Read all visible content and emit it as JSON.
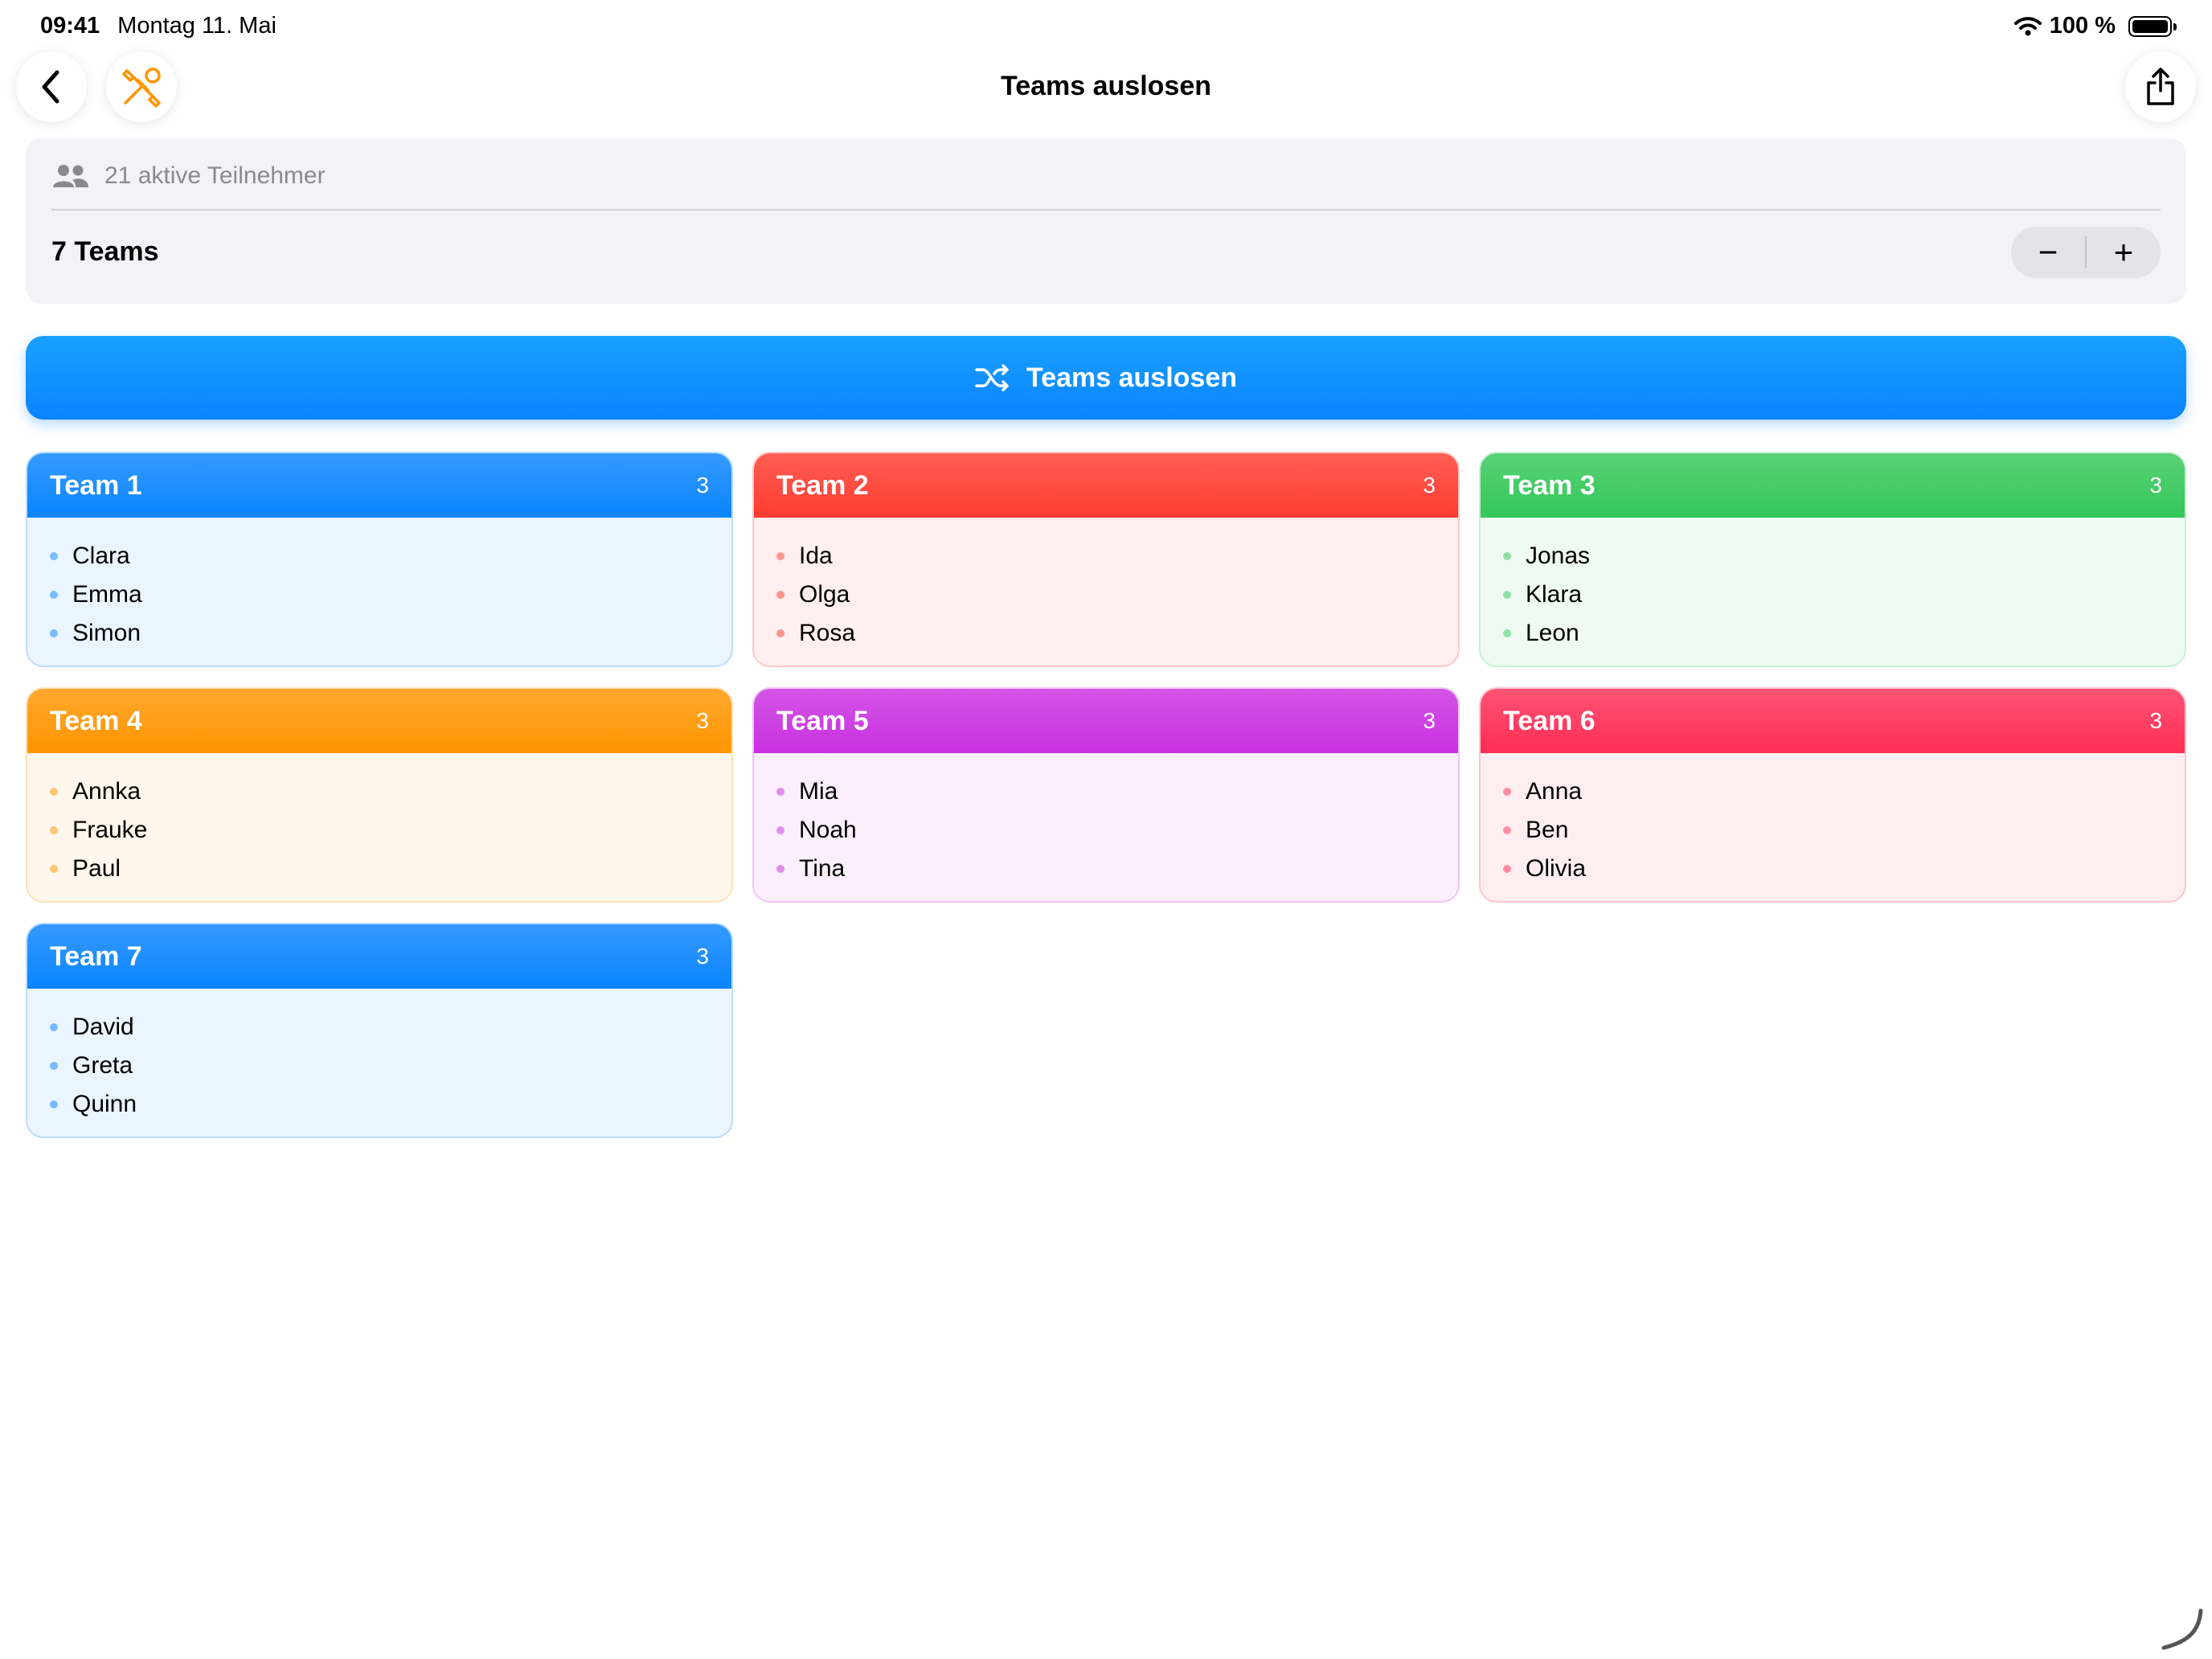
{
  "status_bar": {
    "time": "09:41",
    "date": "Montag 11. Mai",
    "battery": "100 %"
  },
  "nav": {
    "title": "Teams auslosen",
    "back_icon": "chevron-left-icon",
    "tools_icon": "wrench-screwdriver-icon",
    "share_icon": "share-icon",
    "tools_color": "#ff9500"
  },
  "settings": {
    "participants_label": "21 aktive Teilnehmer",
    "teams_label": "7 Teams",
    "minus": "−",
    "plus": "+"
  },
  "shuffle_button": {
    "label": "Teams auslosen",
    "icon": "shuffle-icon"
  },
  "teams": [
    {
      "name": "Team 1",
      "count": "3",
      "color": "#0a84ff",
      "members": [
        "Clara",
        "Emma",
        "Simon"
      ]
    },
    {
      "name": "Team 2",
      "count": "3",
      "color": "#ff3b30",
      "members": [
        "Ida",
        "Olga",
        "Rosa"
      ]
    },
    {
      "name": "Team 3",
      "count": "3",
      "color": "#34c759",
      "members": [
        "Jonas",
        "Klara",
        "Leon"
      ]
    },
    {
      "name": "Team 4",
      "count": "3",
      "color": "#ff9500",
      "members": [
        "Annka",
        "Frauke",
        "Paul"
      ]
    },
    {
      "name": "Team 5",
      "count": "3",
      "color": "#c930e0",
      "members": [
        "Mia",
        "Noah",
        "Tina"
      ]
    },
    {
      "name": "Team 6",
      "count": "3",
      "color": "#ff2d55",
      "members": [
        "Anna",
        "Ben",
        "Olivia"
      ]
    },
    {
      "name": "Team 7",
      "count": "3",
      "color": "#0a84ff",
      "members": [
        "David",
        "Greta",
        "Quinn"
      ]
    }
  ]
}
